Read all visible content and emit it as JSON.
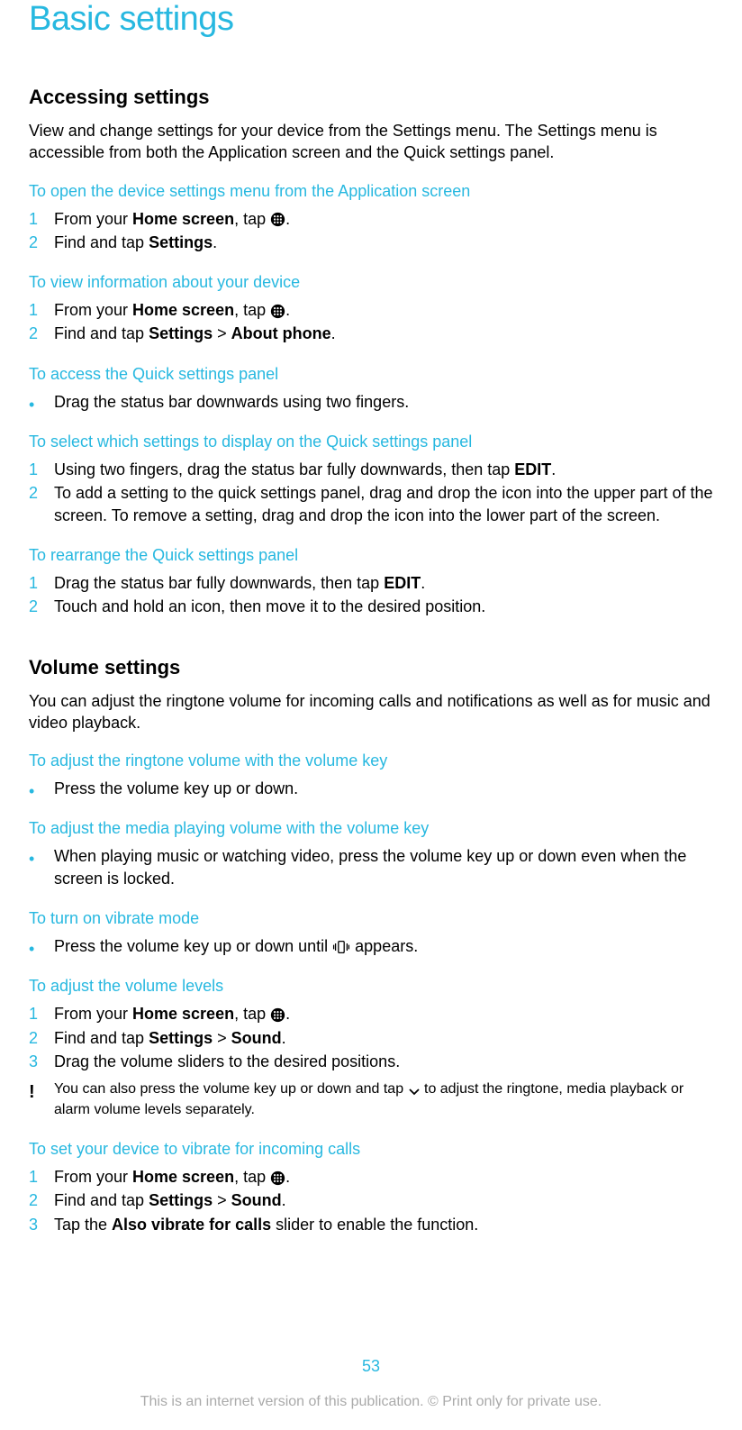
{
  "title": "Basic settings",
  "s1": {
    "title": "Accessing settings",
    "desc": "View and change settings for your device from the Settings menu. The Settings menu is accessible from both the Application screen and the Quick settings panel.",
    "i1": {
      "title": "To open the device settings menu from the Application screen",
      "n1": "1",
      "l1a": "From your ",
      "l1b": "Home screen",
      "l1c": ", tap ",
      "l1d": ".",
      "n2": "2",
      "l2a": "Find and tap ",
      "l2b": "Settings",
      "l2c": "."
    },
    "i2": {
      "title": "To view information about your device",
      "n1": "1",
      "l1a": "From your ",
      "l1b": "Home screen",
      "l1c": ", tap ",
      "l1d": ".",
      "n2": "2",
      "l2a": "Find and tap ",
      "l2b": "Settings",
      "l2c": " > ",
      "l2d": "About phone",
      "l2e": "."
    },
    "i3": {
      "title": "To access the Quick settings panel",
      "l1": "Drag the status bar downwards using two fingers."
    },
    "i4": {
      "title": "To select which settings to display on the Quick settings panel",
      "n1": "1",
      "l1a": "Using two fingers, drag the status bar fully downwards, then tap ",
      "l1b": "EDIT",
      "l1c": ".",
      "n2": "2",
      "l2": "To add a setting to the quick settings panel, drag and drop the icon into the upper part of the screen. To remove a setting, drag and drop the icon into the lower part of the screen."
    },
    "i5": {
      "title": "To rearrange the Quick settings panel",
      "n1": "1",
      "l1a": "Drag the status bar fully downwards, then tap ",
      "l1b": "EDIT",
      "l1c": ".",
      "n2": "2",
      "l2": "Touch and hold an icon, then move it to the desired position."
    }
  },
  "s2": {
    "title": "Volume settings",
    "desc": "You can adjust the ringtone volume for incoming calls and notifications as well as for music and video playback.",
    "i1": {
      "title": "To adjust the ringtone volume with the volume key",
      "l1": "Press the volume key up or down."
    },
    "i2": {
      "title": "To adjust the media playing volume with the volume key",
      "l1": "When playing music or watching video, press the volume key up or down even when the screen is locked."
    },
    "i3": {
      "title": "To turn on vibrate mode",
      "l1a": "Press the volume key up or down until ",
      "l1b": " appears."
    },
    "i4": {
      "title": "To adjust the volume levels",
      "n1": "1",
      "l1a": "From your ",
      "l1b": "Home screen",
      "l1c": ", tap ",
      "l1d": ".",
      "n2": "2",
      "l2a": "Find and tap ",
      "l2b": "Settings",
      "l2c": " > ",
      "l2d": "Sound",
      "l2e": ".",
      "n3": "3",
      "l3": "Drag the volume sliders to the desired positions.",
      "notea": "You can also press the volume key up or down and tap ",
      "noteb": " to adjust the ringtone, media playback or alarm volume levels separately."
    },
    "i5": {
      "title": "To set your device to vibrate for incoming calls",
      "n1": "1",
      "l1a": "From your ",
      "l1b": "Home screen",
      "l1c": ", tap ",
      "l1d": ".",
      "n2": "2",
      "l2a": "Find and tap ",
      "l2b": "Settings",
      "l2c": " > ",
      "l2d": "Sound",
      "l2e": ".",
      "n3": "3",
      "l3a": "Tap the ",
      "l3b": "Also vibrate for calls",
      "l3c": " slider to enable the function."
    }
  },
  "page": "53",
  "footer": "This is an internet version of this publication. © Print only for private use."
}
